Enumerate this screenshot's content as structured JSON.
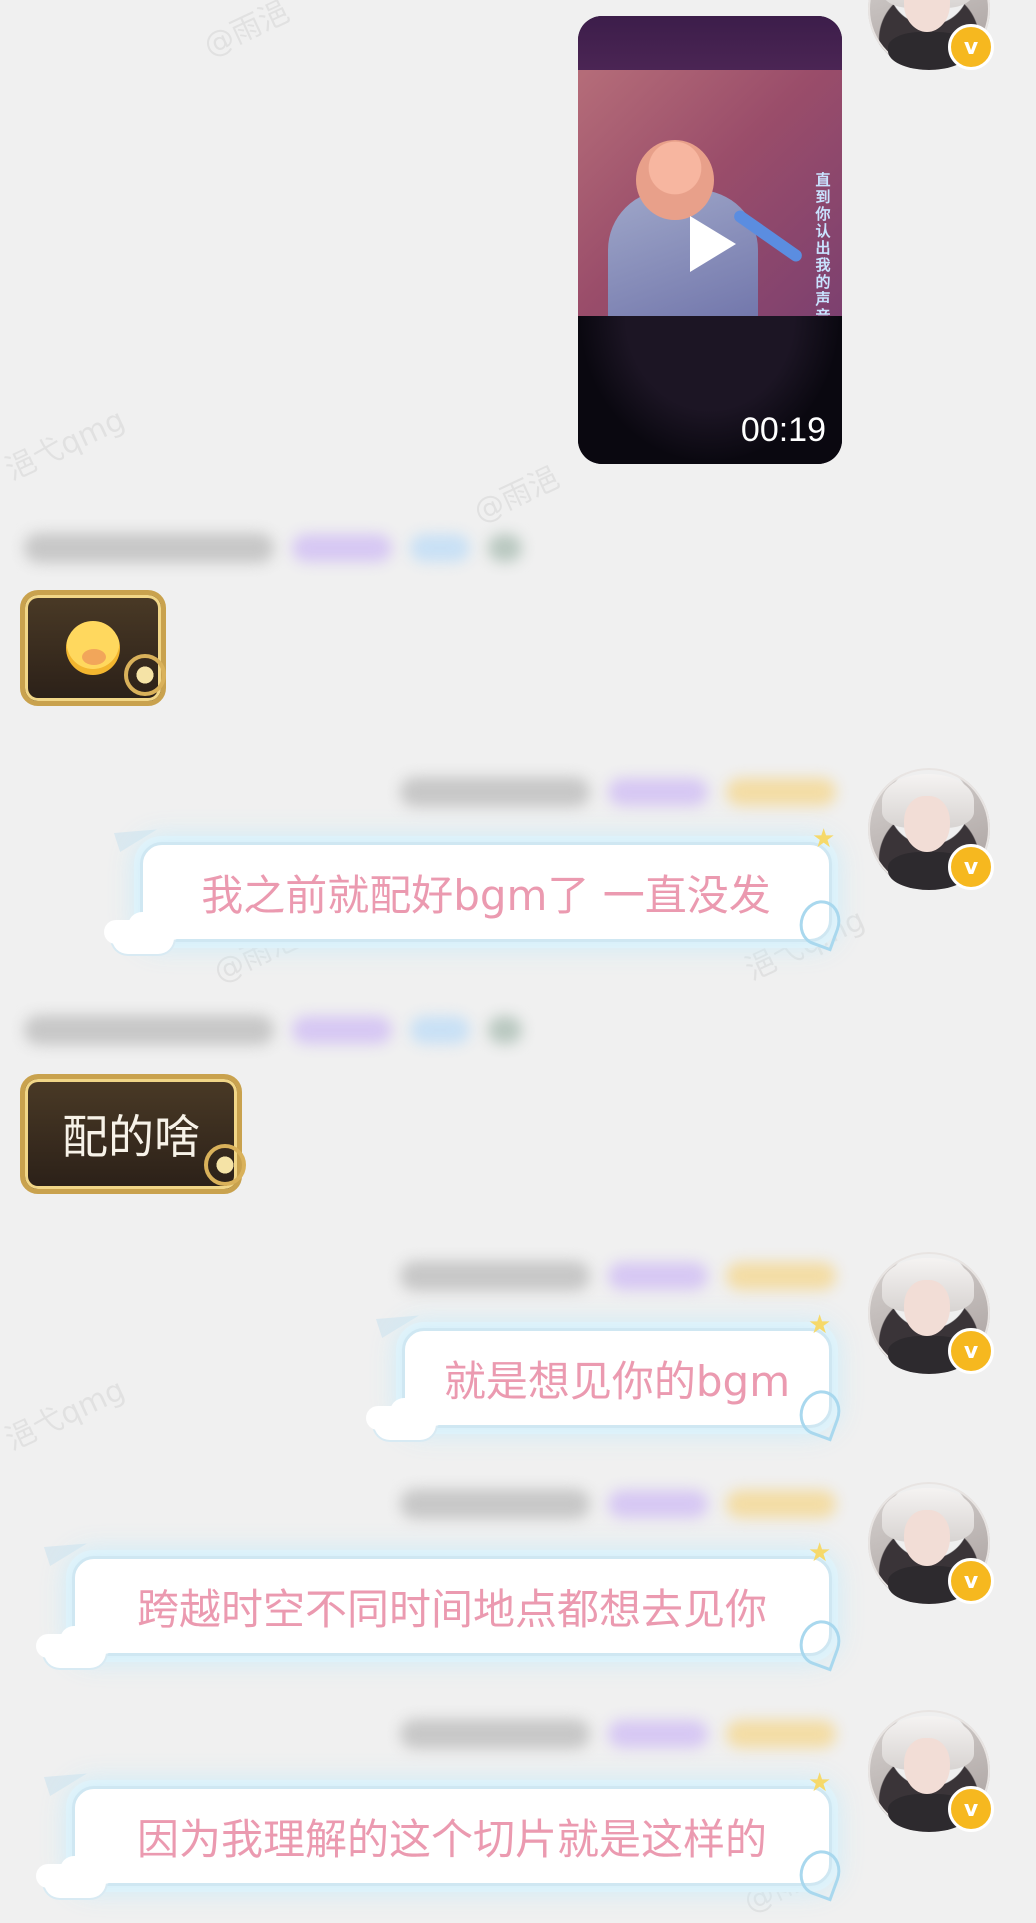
{
  "watermark": "@雨浥",
  "watermark_alt": "浥弋qmg",
  "video": {
    "duration": "00:19",
    "lyrics": "直到你认出我的声音"
  },
  "messages": [
    {
      "side": "other",
      "type": "emoji",
      "emoji_name": "crying-face-icon"
    },
    {
      "side": "self",
      "type": "text",
      "text": "我之前就配好bgm了 一直没发"
    },
    {
      "side": "other",
      "type": "text",
      "text": "配的啥"
    },
    {
      "side": "self",
      "type": "text",
      "text": "就是想见你的bgm"
    },
    {
      "side": "self",
      "type": "text",
      "text": "跨越时空不同时间地点都想去见你"
    },
    {
      "side": "self",
      "type": "text",
      "text": "因为我理解的这个切片就是这样的"
    }
  ],
  "badge": "v",
  "colors": {
    "background": "#f0f0f0",
    "self_text": "#eb9ab0",
    "other_text": "#f7f2e8",
    "vip_badge": "#f6b81f"
  }
}
